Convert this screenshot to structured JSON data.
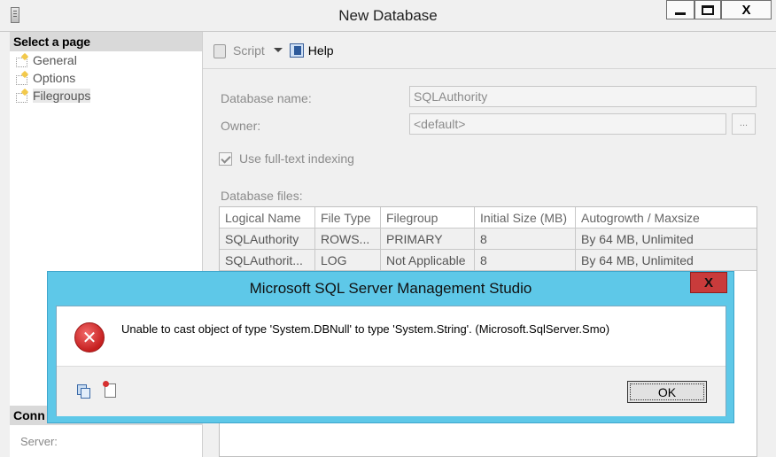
{
  "window": {
    "title": "New Database",
    "close_label": "X"
  },
  "left_pane": {
    "select_page_header": "Select a page",
    "pages": [
      {
        "label": "General"
      },
      {
        "label": "Options"
      },
      {
        "label": "Filegroups"
      }
    ],
    "connection_header": "Conn",
    "server_label": "Server:"
  },
  "toolbar": {
    "script_label": "Script",
    "help_label": "Help"
  },
  "form": {
    "db_name_label": "Database name:",
    "db_name_value": "SQLAuthority",
    "owner_label": "Owner:",
    "owner_value": "<default>",
    "browse_label": "...",
    "fulltext_label": "Use full-text indexing",
    "fulltext_checked": true,
    "files_label": "Database files:"
  },
  "files_table": {
    "columns": [
      "Logical Name",
      "File Type",
      "Filegroup",
      "Initial Size (MB)",
      "Autogrowth / Maxsize"
    ],
    "rows": [
      [
        "SQLAuthority",
        "ROWS...",
        "PRIMARY",
        "8",
        "By 64 MB, Unlimited"
      ],
      [
        "SQLAuthorit...",
        "LOG",
        "Not Applicable",
        "8",
        "By 64 MB, Unlimited"
      ]
    ]
  },
  "dialog": {
    "title": "Microsoft SQL Server Management Studio",
    "close_label": "X",
    "message": "Unable to cast object of type 'System.DBNull' to type 'System.String'. (Microsoft.SqlServer.Smo)",
    "ok_label": "OK",
    "error_glyph": "✕"
  },
  "colors": {
    "dialog_frame": "#5ec8e8",
    "close_red": "#c93b3b",
    "error_red": "#c51f1f"
  }
}
